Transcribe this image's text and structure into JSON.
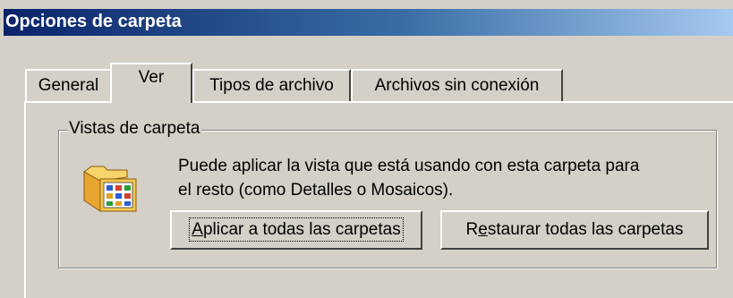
{
  "window": {
    "title": "Opciones de carpeta"
  },
  "tabs": [
    {
      "label": "General",
      "active": false
    },
    {
      "label": "Ver",
      "active": true
    },
    {
      "label": "Tipos de archivo",
      "active": false
    },
    {
      "label": "Archivos sin conexión",
      "active": false
    }
  ],
  "folder_views": {
    "group_label": "Vistas de carpeta",
    "description_line1": "Puede aplicar la vista que está usando con esta carpeta para",
    "description_line2": "el resto (como Detalles o Mosaicos).",
    "apply_button": {
      "mnemonic": "A",
      "rest": "plicar a todas las carpetas"
    },
    "reset_button": {
      "first": "R",
      "mnemonic": "e",
      "rest": "staurar todas las carpetas"
    },
    "icon": "folder-views-icon"
  }
}
